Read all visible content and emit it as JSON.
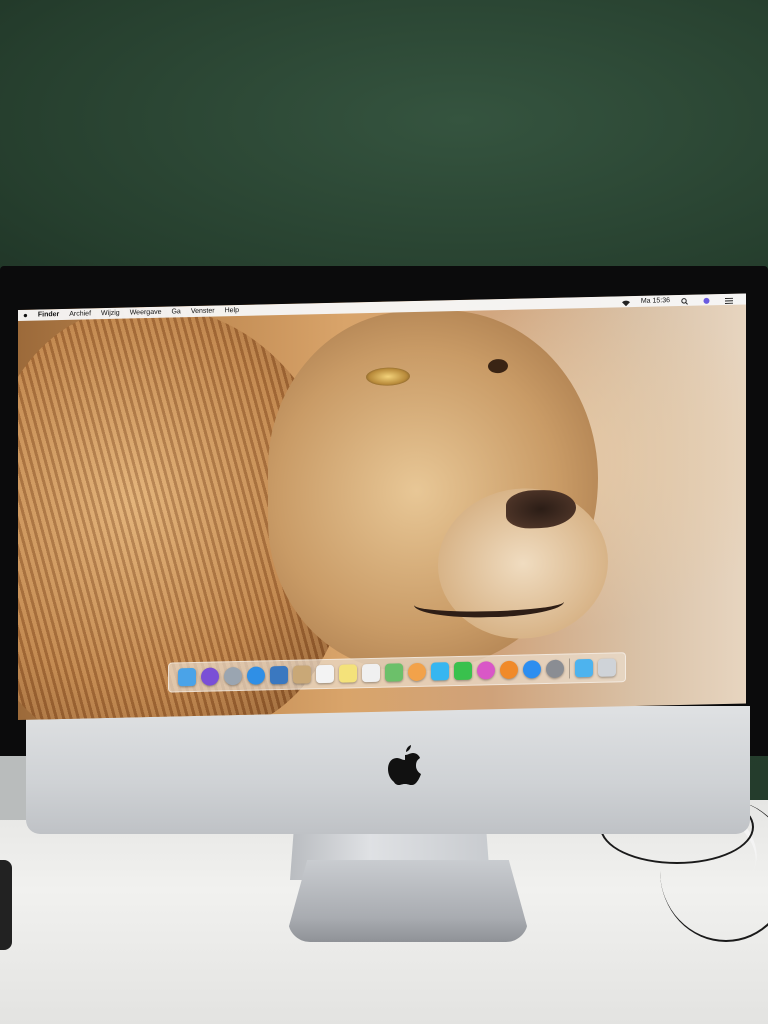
{
  "menubar": {
    "apple_glyph": "",
    "items": [
      "Finder",
      "Archief",
      "Wijzig",
      "Weergave",
      "Ga",
      "Venster",
      "Help"
    ],
    "clock": "Ma 15:36"
  },
  "dock": {
    "icons": [
      {
        "name": "finder-icon",
        "color": "#4aa3e8"
      },
      {
        "name": "siri-icon",
        "color": "#7a4fd6"
      },
      {
        "name": "launchpad-icon",
        "color": "#9aa5b1"
      },
      {
        "name": "safari-icon",
        "color": "#2f8fe6"
      },
      {
        "name": "photo-booth-icon",
        "color": "#3a78c0"
      },
      {
        "name": "contacts-icon",
        "color": "#c9a877"
      },
      {
        "name": "calendar-icon",
        "color": "#f3f3f3"
      },
      {
        "name": "notes-icon",
        "color": "#f4e27a"
      },
      {
        "name": "reminders-icon",
        "color": "#f0f0f0"
      },
      {
        "name": "maps-icon",
        "color": "#6cc06a"
      },
      {
        "name": "photos-icon",
        "color": "#f2a24a"
      },
      {
        "name": "messages-icon",
        "color": "#36b6f0"
      },
      {
        "name": "facetime-icon",
        "color": "#39c14d"
      },
      {
        "name": "itunes-icon",
        "color": "#d957c7"
      },
      {
        "name": "books-icon",
        "color": "#f08a2a"
      },
      {
        "name": "app-store-icon",
        "color": "#2d8ef0"
      },
      {
        "name": "system-preferences-icon",
        "color": "#8a8d93"
      },
      {
        "name": "downloads-folder-icon",
        "color": "#4db3ee"
      },
      {
        "name": "trash-icon",
        "color": "#cfd3d8"
      }
    ]
  }
}
